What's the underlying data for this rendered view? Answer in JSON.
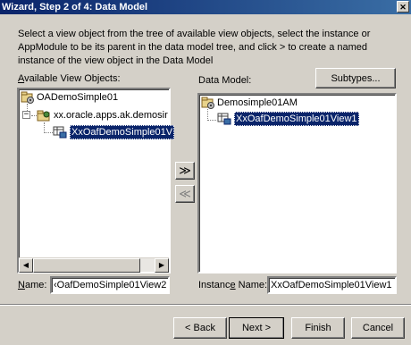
{
  "window": {
    "title": "Wizard, Step 2 of 4: Data Model",
    "close_glyph": "✕"
  },
  "description": "Select a view object from the tree of available view objects, select the instance or AppModule to be its parent in the data model tree, and click > to create a named instance of the view object in the Data Model",
  "available": {
    "label_mnemonic": "A",
    "label_rest": "vailable View Objects:",
    "tree": {
      "root": "OADemoSimple01",
      "package": "xx.oracle.apps.ak.demosir",
      "view_object": "XxOafDemoSimple01V"
    },
    "name_label_mnemonic": "N",
    "name_label_rest": "ame:",
    "name_value": "‹OafDemoSimple01View2"
  },
  "data_model": {
    "label": "Data Model:",
    "subtypes_button": "Subtypes...",
    "tree": {
      "root": "Demosimple01AM",
      "instance": "XxOafDemoSimple01View1"
    },
    "instance_label_pre": "Instanc",
    "instance_label_mnemonic": "e",
    "instance_label_post": " Name:",
    "instance_value": "XxOafDemoSimple01View1"
  },
  "transfer": {
    "add_glyph": "≫",
    "remove_glyph": "≪"
  },
  "footer": {
    "back": "< Back",
    "back_mnemonic": "B",
    "next": "Next >",
    "next_mnemonic": "N",
    "finish": "Finish",
    "cancel": "Cancel"
  },
  "scroll": {
    "left_glyph": "◀",
    "right_glyph": "▶"
  }
}
